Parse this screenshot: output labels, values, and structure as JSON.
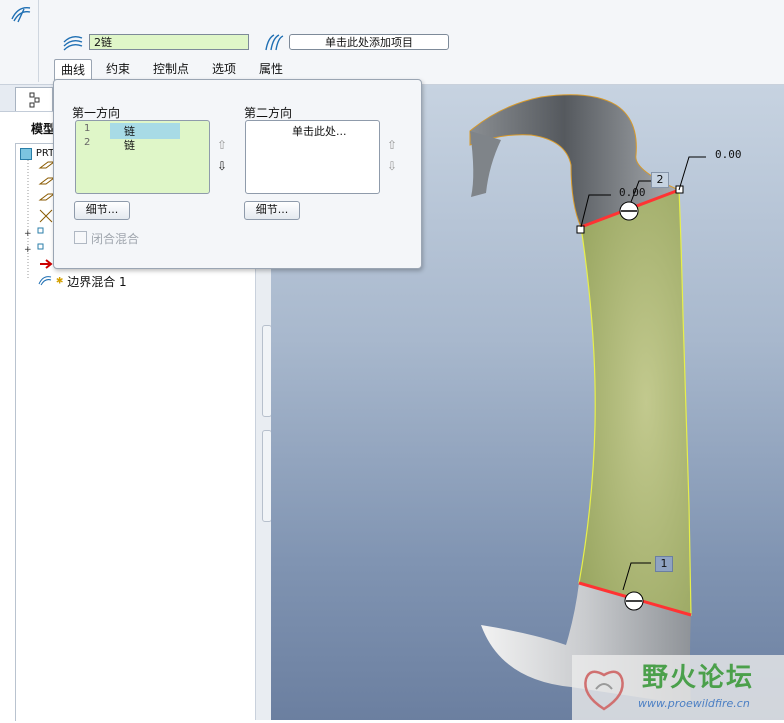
{
  "toolbar": {
    "chain_value": "2链",
    "add_item_label": "单击此处添加项目"
  },
  "tabs": [
    {
      "label": "曲线",
      "active": true
    },
    {
      "label": "约束",
      "active": false
    },
    {
      "label": "控制点",
      "active": false
    },
    {
      "label": "选项",
      "active": false
    },
    {
      "label": "属性",
      "active": false
    }
  ],
  "popup": {
    "first_direction": {
      "title": "第一方向",
      "rows": [
        {
          "index": "1",
          "label": "链"
        },
        {
          "index": "2",
          "label": "链"
        }
      ],
      "details_button": "细节..."
    },
    "second_direction": {
      "title": "第二方向",
      "placeholder": "单击此处...",
      "details_button": "细节..."
    },
    "closed_blend_label": "闭合混合"
  },
  "model_tree": {
    "tab_label": "模型",
    "root_label": "PRT",
    "feature_label": "边界混合 1"
  },
  "viewport": {
    "dims": [
      {
        "label": "0.00"
      },
      {
        "label": "0.00"
      }
    ],
    "tags": [
      {
        "label": "2"
      },
      {
        "label": "1"
      }
    ]
  },
  "watermark": {
    "title": "野火论坛",
    "url": "www.proewildfire.cn"
  },
  "colors": {
    "surface_fill": "#a7b46b",
    "curve_red": "#ff3333",
    "curve_yellow": "#f3ff2e"
  }
}
